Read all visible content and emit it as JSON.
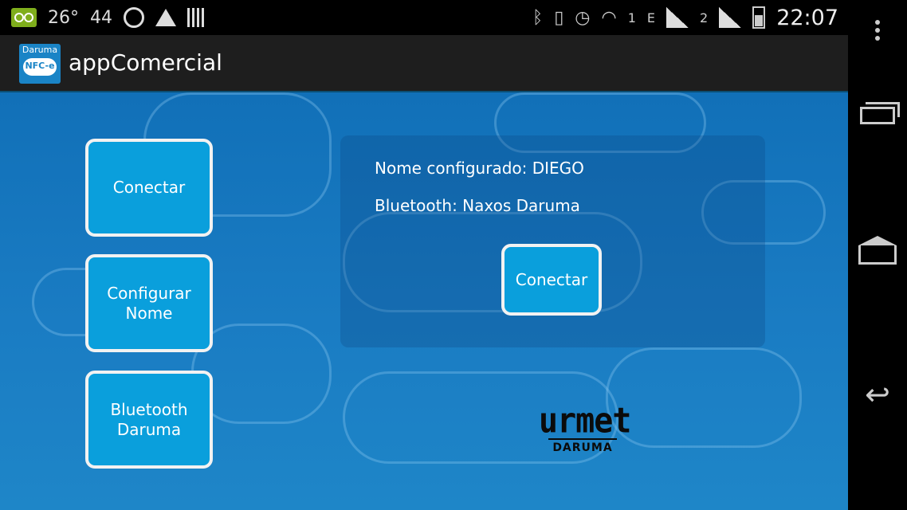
{
  "status_bar": {
    "temperature": "26°",
    "number": "44",
    "network_1": "1",
    "network_type": "E",
    "network_2": "2",
    "time": "22:07",
    "icons": [
      "voicemail-icon",
      "whatsapp-icon",
      "triangle-app-icon",
      "barcode-icon",
      "bluetooth-icon",
      "vibrate-icon",
      "alarm-icon",
      "wifi-icon",
      "signal-icon",
      "battery-icon"
    ]
  },
  "action_bar": {
    "app_icon_top": "Daruma",
    "app_icon_badge": "NFC-e",
    "title": "appComercial"
  },
  "menu": {
    "connect": "Conectar",
    "configure_name": "Configurar Nome",
    "bluetooth": "Bluetooth Daruma"
  },
  "info_panel": {
    "name_line": "Nome configurado: DIEGO",
    "bluetooth_line": "Bluetooth:  Naxos Daruma",
    "connect_button": "Conectar"
  },
  "logo": {
    "main": "urmet",
    "sub": "DARUMA"
  },
  "nav_bar": {
    "icons": [
      "overflow-menu-icon",
      "recents-icon",
      "home-icon",
      "back-icon"
    ]
  },
  "colors": {
    "button_blue": "#0a9fdc",
    "background_blue": "#1a7cc3",
    "action_bar": "#1e1e1e"
  }
}
